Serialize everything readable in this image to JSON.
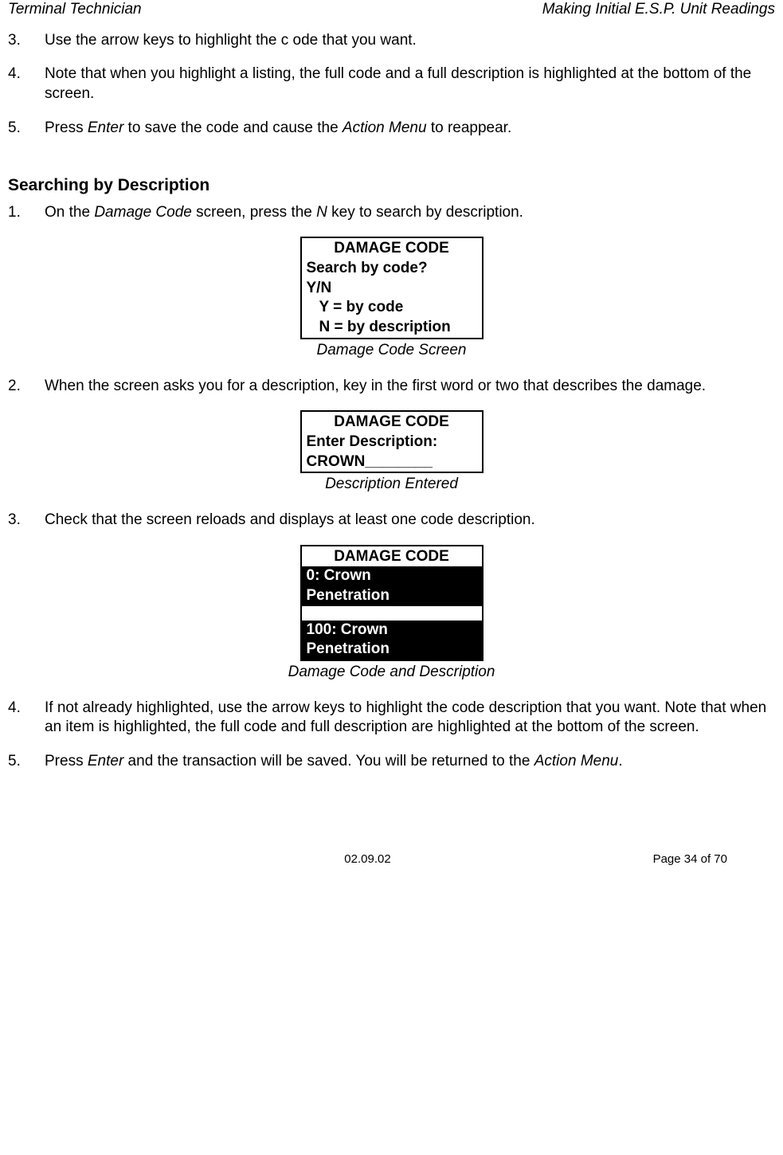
{
  "header": {
    "left": "Terminal Technician",
    "right": "Making Initial E.S.P. Unit Readings"
  },
  "top_steps": {
    "s3": {
      "num": "3.",
      "text": "Use the arrow keys to highlight the c ode that you want."
    },
    "s4": {
      "num": "4.",
      "text": "Note that when you highlight a listing, the full code and a full description is highlighted at the bottom of the screen."
    },
    "s5": {
      "num": "5.",
      "t1": "Press ",
      "i1": "Enter",
      "t2": " to save the code and cause the ",
      "i2": "Action Menu",
      "t3": " to reappear."
    }
  },
  "section_heading": "Searching by Description",
  "desc_steps": {
    "s1": {
      "num": "1.",
      "t1": "On the ",
      "i1": "Damage Code",
      "t2": " screen, press the ",
      "i2": "N",
      "t3": " key to search by description."
    },
    "s2": {
      "num": "2.",
      "text": "When the screen asks you for a description, key in the first word or two that describes the damage."
    },
    "s3": {
      "num": "3.",
      "text": "Check that the screen reloads and displays at least one code description."
    },
    "s4": {
      "num": "4.",
      "text": "If not already highlighted, use the arrow keys to highlight the code description that you want. Note that when an item is highlighted, the full code and full description are highlighted at the bottom of the screen."
    },
    "s5": {
      "num": "5.",
      "t1": "Press ",
      "i1": "Enter",
      "t2": " and the transaction will be saved.  You will be returned to the ",
      "i2": "Action Menu",
      "t3": "."
    }
  },
  "screen1": {
    "title": "DAMAGE CODE",
    "l1": "Search by code?",
    "l2": "Y/N",
    "l3": "Y = by code",
    "l4": "N = by description",
    "caption": "Damage Code Screen"
  },
  "screen2": {
    "title": "DAMAGE CODE",
    "l1": "Enter Description:",
    "l2": "CROWN________",
    "caption": "Description Entered"
  },
  "screen3": {
    "title": "DAMAGE CODE",
    "r1a": "0: Crown",
    "r1b": "Penetration",
    "r2a": "100: Crown",
    "r2b": "Penetration",
    "caption": "Damage Code and Description"
  },
  "footer": {
    "date": "02.09.02",
    "page": "Page 34 of 70"
  }
}
